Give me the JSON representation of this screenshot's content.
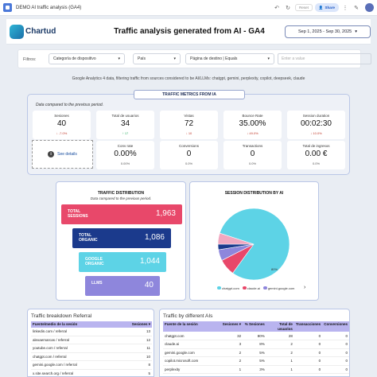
{
  "topbar": {
    "doc_title": "DEMO AI traffic analysis (GA4)",
    "reset_label": "Reset",
    "share_label": "Share"
  },
  "header": {
    "logo_text": "Chartud",
    "title": "Traffic analysis generated from AI - GA4",
    "date_range": "Sep 1, 2025 - Sep 30, 2025"
  },
  "filters": {
    "label": "Filtros:",
    "device": "Categoría de dispositivo",
    "country": "País",
    "landing_page": "Página de destino",
    "match_type": "Equals",
    "input_placeholder": "Enter a value"
  },
  "description": "Google Analytics 4 data, filtering traffic from sources considered to be AI/LLMs: chatgpt, gemini, perplexity, copilot, deepseek, claude",
  "metrics": {
    "title": "TRAFFIC METRICS FROM IA",
    "note": "Data compared to the previous period.",
    "see_details": "See details",
    "cards": [
      {
        "label": "Sesiones",
        "value": "40",
        "change": "↓ -7.0%",
        "dir": "neg"
      },
      {
        "label": "Total de usuarios",
        "value": "34",
        "change": "↑ 17",
        "dir": "pos"
      },
      {
        "label": "Vistas",
        "value": "72",
        "change": "↓ 10",
        "dir": "neg"
      },
      {
        "label": "Bounce Rate",
        "value": "35.00%",
        "change": "↓ 49.0%",
        "dir": "neg"
      },
      {
        "label": "Session duration",
        "value": "00:02:30",
        "change": "↓ 10.0%",
        "dir": "neg"
      },
      {
        "label": "Conv rate",
        "value": "0.00%",
        "change": "0.00%",
        "dir": ""
      },
      {
        "label": "Conversions",
        "value": "0",
        "change": "0.0%",
        "dir": ""
      },
      {
        "label": "Transactions",
        "value": "0",
        "change": "0.0%",
        "dir": ""
      },
      {
        "label": "Total de ingresos",
        "value": "0.00 €",
        "change": "0.0%",
        "dir": ""
      }
    ]
  },
  "distribution": {
    "title": "TRAFFIC DISTRIBUTION",
    "note": "Data compared to the previous period.",
    "bars": [
      {
        "label": "TOTAL SESSIONS",
        "value": "1,963",
        "change": "↓ 7.0%",
        "color": "#e8486a"
      },
      {
        "label": "TOTAL ORGANIC",
        "value": "1,086",
        "change": "↓ 10.7%",
        "color": "#1b3a8c"
      },
      {
        "label": "GOOGLE ORGANIC",
        "value": "1,044",
        "change": "↓ 9.7%",
        "color": "#5dd3e6"
      },
      {
        "label": "LLMS",
        "value": "40",
        "change": "↓ 7.0%",
        "color": "#8e86dc"
      }
    ]
  },
  "pie": {
    "title": "SESSION DISTRIBUTION BY AI",
    "legend": [
      "chatgpt.com",
      "claude.ai",
      "gemini.google.com"
    ],
    "big_label": "80%",
    "slices": [
      {
        "name": "chatgpt.com",
        "value": 80,
        "color": "#5dd3e6"
      },
      {
        "name": "claude.ai",
        "value": 7.5,
        "color": "#e8486a"
      },
      {
        "name": "gemini.google.com",
        "value": 5,
        "color": "#8e86dc"
      },
      {
        "name": "perplexity",
        "value": 2.5,
        "color": "#1b3a8c"
      },
      {
        "name": "copilot",
        "value": 5,
        "color": "#f0a8c0"
      }
    ]
  },
  "referral": {
    "title": "Traffic breakdown Referral",
    "headers": [
      "Fuente/medio de la sesión",
      "Sesiones ▾"
    ],
    "rows": [
      [
        "linkedin.com / referral",
        "13"
      ],
      [
        "alexaemarcas / referral",
        "12"
      ],
      [
        "youtube.com / referral",
        "11"
      ],
      [
        "chatgpt.com / referral",
        "10"
      ],
      [
        "gemini.google.com / referral",
        "8"
      ],
      [
        "x.site.search.org / referral",
        "5"
      ],
      [
        "ai.google.com / referral",
        "5"
      ],
      [
        "online.semanticrg.com / referral",
        "5"
      ]
    ]
  },
  "ai_table": {
    "title": "Traffic by different AIs",
    "headers": [
      "Fuente de la sesión",
      "Sesiones ▾",
      "% Sesiones",
      "Total de usuarios",
      "Transacciones",
      "Conversiones"
    ],
    "rows": [
      [
        "chatgpt.com",
        "32",
        "80%",
        "28",
        "0",
        "0"
      ],
      [
        "claude.ai",
        "3",
        "8%",
        "2",
        "0",
        "0"
      ],
      [
        "gemini.google.com",
        "2",
        "5%",
        "2",
        "0",
        "0"
      ],
      [
        "copilot.microsoft.com",
        "2",
        "5%",
        "1",
        "0",
        "0"
      ],
      [
        "perplexity",
        "1",
        "3%",
        "1",
        "0",
        "0"
      ]
    ]
  }
}
